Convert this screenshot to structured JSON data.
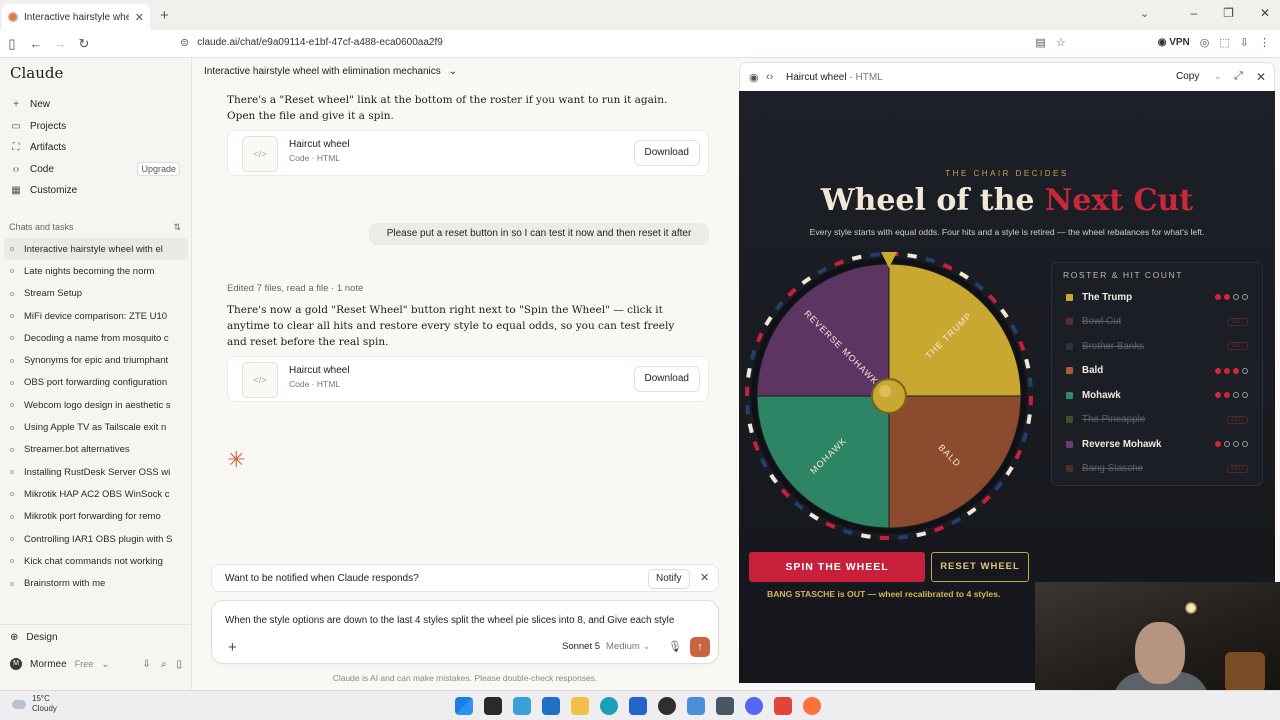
{
  "browser": {
    "tab_title": "Interactive hairstyle wheel with",
    "url": "claude.ai/chat/e9a09114-e1bf-47cf-a488-eca0600aa2f9",
    "vpn": "VPN"
  },
  "sidebar": {
    "logo": "Claude",
    "nav": [
      {
        "label": "New",
        "icon": "plus-icon"
      },
      {
        "label": "Projects",
        "icon": "folder-icon"
      },
      {
        "label": "Artifacts",
        "icon": "artifacts-icon"
      },
      {
        "label": "Code",
        "icon": "code-icon",
        "badge": "Upgrade"
      },
      {
        "label": "Customize",
        "icon": "customize-icon"
      }
    ],
    "chats_heading": "Chats and tasks",
    "chats": [
      "Interactive hairstyle wheel with el",
      "Late nights becoming the norm",
      "Stream Setup",
      "MiFi device comparison: ZTE U10",
      "Decoding a name from mosquito c",
      "Synonyms for epic and triumphant",
      "OBS port forwarding configuration",
      "Webcom logo design in aesthetic s",
      "Using Apple TV as Tailscale exit n",
      "Streamer.bot alternatives",
      "Installing RustDesk Server OSS wi",
      "Mikrotik HAP AC2 OBS WinSock c",
      "Mikrotik port forwarding for remo",
      "Controlling IAR1 OBS plugin with S",
      "Kick chat commands not working",
      "Brainstorm with me"
    ],
    "design": "Design",
    "user_name": "Mormee",
    "user_plan": "Free",
    "avatar": "M"
  },
  "conversation": {
    "title": "Interactive hairstyle wheel with elimination mechanics",
    "msg1": "There's a \"Reset wheel\" link at the bottom of the roster if you want to run it again. Open the file and give it a spin.",
    "artifact_name": "Haircut wheel",
    "artifact_sub": "Code · HTML",
    "download": "Download",
    "user_msg": "Please put a reset button in so I can test it now and then reset it after",
    "edited": "Edited 7 files, read a file · 1 note",
    "msg2": "There's now a gold \"Reset Wheel\" button right next to \"Spin the Wheel\" — click it anytime to clear all hits and restore every style to equal odds, so you can test freely and reset before the real spin.",
    "notify_q": "Want to be notified when Claude responds?",
    "notify_btn": "Notify",
    "composer_text": "When the style options are down to the last 4 styles split the wheel pie slices into 8, and Give each style",
    "model": "Sonnet 5",
    "effort": "Medium",
    "disclaimer": "Claude is AI and can make mistakes. Please double-check responses."
  },
  "artifact_panel": {
    "title": "Haircut wheel",
    "kind": "HTML",
    "copy": "Copy",
    "kicker": "THE CHAIR DECIDES",
    "headline_a": "Wheel of the ",
    "headline_b": "Next Cut",
    "tagline": "Every style starts with equal odds. Four hits and a style is retired — the wheel rebalances for what's left.",
    "roster_heading": "ROSTER & HIT COUNT",
    "out_tag": "OUT",
    "roster": [
      {
        "name": "The Trump",
        "color": "#c9a832",
        "hits": 2,
        "out": false
      },
      {
        "name": "Bowl Cut",
        "color": "#b5323d",
        "hits": 4,
        "out": true
      },
      {
        "name": "Brother Banks",
        "color": "#36527e",
        "hits": 4,
        "out": true
      },
      {
        "name": "Bald",
        "color": "#a85a3a",
        "hits": 3,
        "out": false
      },
      {
        "name": "Mohawk",
        "color": "#2e8a6b",
        "hits": 2,
        "out": false
      },
      {
        "name": "The Pineapple",
        "color": "#7c8a2e",
        "hits": 4,
        "out": true
      },
      {
        "name": "Reverse Mohawk",
        "color": "#6e3b6e",
        "hits": 1,
        "out": false
      },
      {
        "name": "Bang Stasche",
        "color": "#8a4a2e",
        "hits": 4,
        "out": true
      }
    ],
    "wheel_labels": [
      "THE TRUMP",
      "BALD",
      "MOHAWK",
      "REVERSE MOHAWK"
    ],
    "wheel_colors": [
      "#c9a832",
      "#8c4a2e",
      "#2e8565",
      "#5c3563"
    ],
    "spin_label": "SPIN THE WHEEL",
    "reset_label": "RESET WHEEL",
    "status": "BANG STASCHE is OUT — wheel recalibrated to 4 styles."
  },
  "taskbar": {
    "temp": "15°C",
    "condition": "Cloudy"
  }
}
